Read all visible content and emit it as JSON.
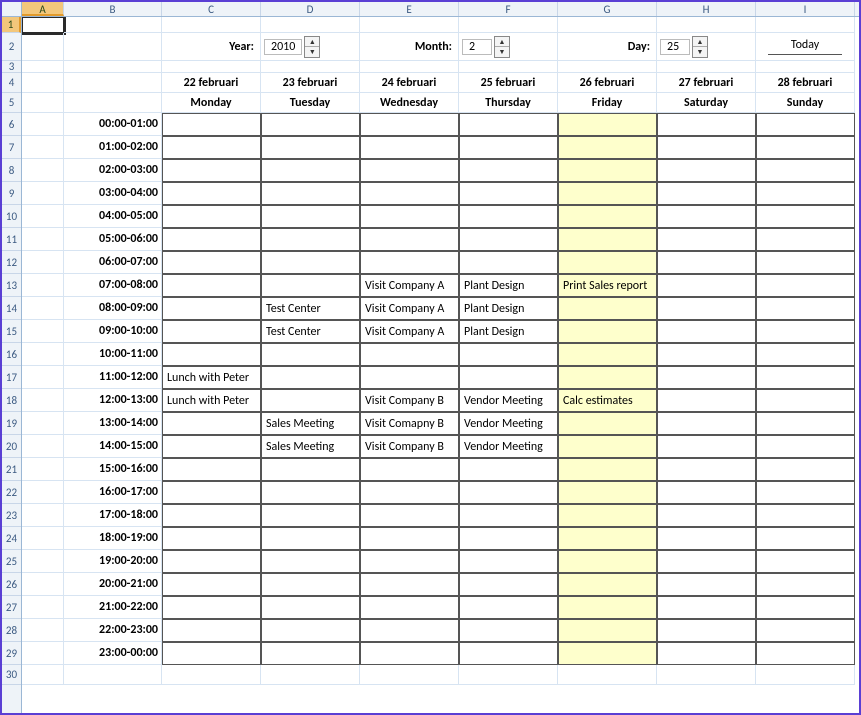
{
  "columns": [
    "A",
    "B",
    "C",
    "D",
    "E",
    "F",
    "G",
    "H",
    "I"
  ],
  "controls": {
    "year_label": "Year:",
    "year_value": "2010",
    "month_label": "Month:",
    "month_value": "2",
    "day_label": "Day:",
    "day_value": "25",
    "today_label": "Today"
  },
  "days": [
    {
      "date": "22 februari",
      "name": "Monday"
    },
    {
      "date": "23 februari",
      "name": "Tuesday"
    },
    {
      "date": "24 februari",
      "name": "Wednesday"
    },
    {
      "date": "25 februari",
      "name": "Thursday"
    },
    {
      "date": "26 februari",
      "name": "Friday"
    },
    {
      "date": "27 februari",
      "name": "Saturday"
    },
    {
      "date": "28 februari",
      "name": "Sunday"
    }
  ],
  "highlight_day_index": 4,
  "slots": [
    {
      "time": "00:00-01:00",
      "c": [
        "",
        "",
        "",
        "",
        "",
        "",
        ""
      ]
    },
    {
      "time": "01:00-02:00",
      "c": [
        "",
        "",
        "",
        "",
        "",
        "",
        ""
      ]
    },
    {
      "time": "02:00-03:00",
      "c": [
        "",
        "",
        "",
        "",
        "",
        "",
        ""
      ]
    },
    {
      "time": "03:00-04:00",
      "c": [
        "",
        "",
        "",
        "",
        "",
        "",
        ""
      ]
    },
    {
      "time": "04:00-05:00",
      "c": [
        "",
        "",
        "",
        "",
        "",
        "",
        ""
      ]
    },
    {
      "time": "05:00-06:00",
      "c": [
        "",
        "",
        "",
        "",
        "",
        "",
        ""
      ]
    },
    {
      "time": "06:00-07:00",
      "c": [
        "",
        "",
        "",
        "",
        "",
        "",
        ""
      ]
    },
    {
      "time": "07:00-08:00",
      "c": [
        "",
        "",
        "Visit Company A",
        "Plant Design",
        "Print Sales report",
        "",
        ""
      ]
    },
    {
      "time": "08:00-09:00",
      "c": [
        "",
        "Test Center",
        "Visit Company A",
        "Plant Design",
        "",
        "",
        ""
      ]
    },
    {
      "time": "09:00-10:00",
      "c": [
        "",
        "Test Center",
        "Visit Company A",
        "Plant Design",
        "",
        "",
        ""
      ]
    },
    {
      "time": "10:00-11:00",
      "c": [
        "",
        "",
        "",
        "",
        "",
        "",
        ""
      ]
    },
    {
      "time": "11:00-12:00",
      "c": [
        "Lunch with Peter",
        "",
        "",
        "",
        "",
        "",
        ""
      ]
    },
    {
      "time": "12:00-13:00",
      "c": [
        "Lunch with Peter",
        "",
        "Visit Company B",
        "Vendor Meeting",
        "Calc estimates",
        "",
        ""
      ]
    },
    {
      "time": "13:00-14:00",
      "c": [
        "",
        "Sales Meeting",
        "Visit Comapny B",
        "Vendor Meeting",
        "",
        "",
        ""
      ]
    },
    {
      "time": "14:00-15:00",
      "c": [
        "",
        "Sales Meeting",
        "Visit Company B",
        "Vendor Meeting",
        "",
        "",
        ""
      ]
    },
    {
      "time": "15:00-16:00",
      "c": [
        "",
        "",
        "",
        "",
        "",
        "",
        ""
      ]
    },
    {
      "time": "16:00-17:00",
      "c": [
        "",
        "",
        "",
        "",
        "",
        "",
        ""
      ]
    },
    {
      "time": "17:00-18:00",
      "c": [
        "",
        "",
        "",
        "",
        "",
        "",
        ""
      ]
    },
    {
      "time": "18:00-19:00",
      "c": [
        "",
        "",
        "",
        "",
        "",
        "",
        ""
      ]
    },
    {
      "time": "19:00-20:00",
      "c": [
        "",
        "",
        "",
        "",
        "",
        "",
        ""
      ]
    },
    {
      "time": "20:00-21:00",
      "c": [
        "",
        "",
        "",
        "",
        "",
        "",
        ""
      ]
    },
    {
      "time": "21:00-22:00",
      "c": [
        "",
        "",
        "",
        "",
        "",
        "",
        ""
      ]
    },
    {
      "time": "22:00-23:00",
      "c": [
        "",
        "",
        "",
        "",
        "",
        "",
        ""
      ]
    },
    {
      "time": "23:00-00:00",
      "c": [
        "",
        "",
        "",
        "",
        "",
        "",
        ""
      ]
    }
  ]
}
